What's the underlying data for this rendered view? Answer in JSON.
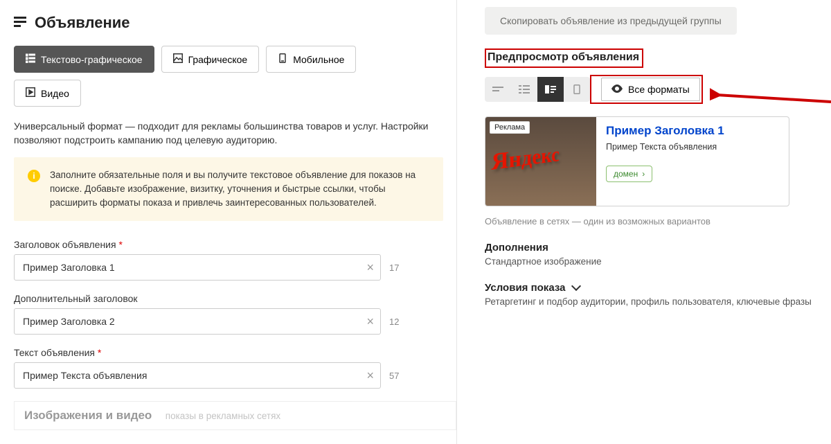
{
  "page": {
    "title": "Объявление",
    "tabs": [
      {
        "label": "Текстово-графическое"
      },
      {
        "label": "Графическое"
      },
      {
        "label": "Мобильное"
      },
      {
        "label": "Видео"
      }
    ],
    "description": "Универсальный формат — подходит для рекламы большинства товаров и услуг. Настройки позволяют подстроить кампанию под целевую аудиторию.",
    "infobox": "Заполните обязательные поля и вы получите текстовое объявление для показов на поиске. Добавьте изображение, визитку, уточнения и быстрые ссылки, чтобы расширить форматы показа и привлечь заинтересованных пользователей."
  },
  "form": {
    "headline": {
      "label": "Заголовок объявления",
      "value": "Пример Заголовка 1",
      "counter": "17"
    },
    "subheadline": {
      "label": "Дополнительный заголовок",
      "value": "Пример Заголовка 2",
      "counter": "12"
    },
    "adtext": {
      "label": "Текст объявления",
      "value": "Пример Текста объявления",
      "counter": "57"
    },
    "media": {
      "title": "Изображения и видео",
      "subtitle": "показы в рекламных сетях"
    }
  },
  "preview": {
    "copy_button": "Скопировать объявление из предыдущей группы",
    "title": "Предпросмотр объявления",
    "all_formats_label": "Все форматы",
    "ad_card": {
      "tag": "Реклама",
      "title": "Пример Заголовка 1",
      "text": "Пример Текста объявления",
      "domain": "домен"
    },
    "note": "Объявление в сетях — один из возможных вариантов",
    "extensions": {
      "title": "Дополнения",
      "line": "Стандартное изображение"
    },
    "conditions": {
      "title": "Условия показа",
      "line": "Ретаргетинг и подбор аудитории, профиль пользователя, ключевые фразы"
    }
  }
}
